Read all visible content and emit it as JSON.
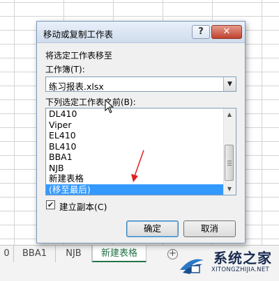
{
  "dialog": {
    "title": "移动或复制工作表",
    "help_label": "?",
    "close_label": "✕",
    "move_to_label": "将选定工作表移至",
    "workbook_label": "工作簿(T):",
    "workbook_value": "练习报表.xlsx",
    "before_label": "下列选定工作表之前(B):",
    "sheets": [
      "DL410",
      "Viper",
      "EL410",
      "BL410",
      "BBA1",
      "NJB",
      "新建表格",
      "(移至最后)"
    ],
    "selected_sheet": "(移至最后)",
    "create_copy_label": "建立副本(C)",
    "create_copy_checked": true,
    "ok_label": "确定",
    "cancel_label": "取消"
  },
  "sheet_tabs": [
    {
      "label": "0",
      "active": false
    },
    {
      "label": "BBA1",
      "active": false
    },
    {
      "label": "NJB",
      "active": false
    },
    {
      "label": "新建表格",
      "active": true
    }
  ],
  "add_sheet_label": "+",
  "watermark": {
    "title": "系统之家",
    "url": "XITONGZHIJIA.NET"
  },
  "colors": {
    "selection": "#3399ff",
    "active_tab": "#217346",
    "annotation_arrow": "#e02020"
  }
}
